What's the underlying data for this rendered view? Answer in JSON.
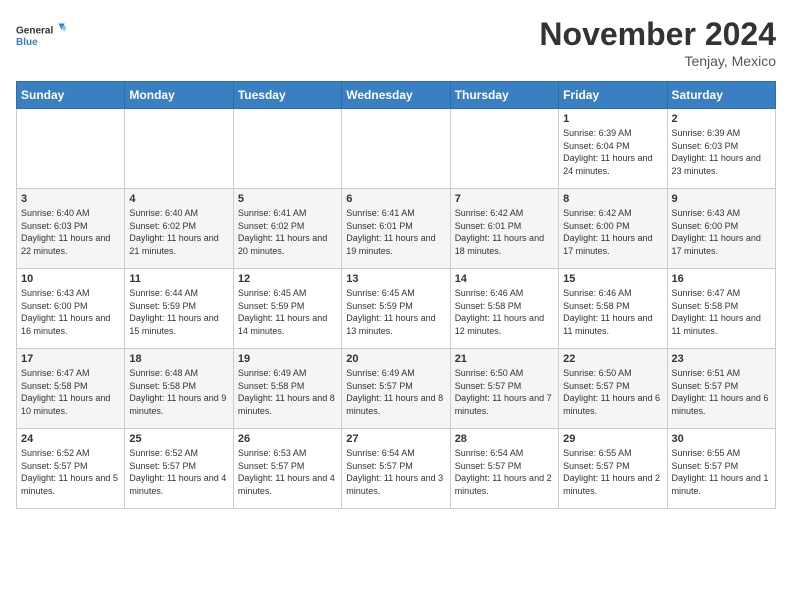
{
  "header": {
    "logo_general": "General",
    "logo_blue": "Blue",
    "month_title": "November 2024",
    "location": "Tenjay, Mexico"
  },
  "days_of_week": [
    "Sunday",
    "Monday",
    "Tuesday",
    "Wednesday",
    "Thursday",
    "Friday",
    "Saturday"
  ],
  "weeks": [
    [
      {
        "day": "",
        "info": ""
      },
      {
        "day": "",
        "info": ""
      },
      {
        "day": "",
        "info": ""
      },
      {
        "day": "",
        "info": ""
      },
      {
        "day": "",
        "info": ""
      },
      {
        "day": "1",
        "info": "Sunrise: 6:39 AM\nSunset: 6:04 PM\nDaylight: 11 hours and 24 minutes."
      },
      {
        "day": "2",
        "info": "Sunrise: 6:39 AM\nSunset: 6:03 PM\nDaylight: 11 hours and 23 minutes."
      }
    ],
    [
      {
        "day": "3",
        "info": "Sunrise: 6:40 AM\nSunset: 6:03 PM\nDaylight: 11 hours and 22 minutes."
      },
      {
        "day": "4",
        "info": "Sunrise: 6:40 AM\nSunset: 6:02 PM\nDaylight: 11 hours and 21 minutes."
      },
      {
        "day": "5",
        "info": "Sunrise: 6:41 AM\nSunset: 6:02 PM\nDaylight: 11 hours and 20 minutes."
      },
      {
        "day": "6",
        "info": "Sunrise: 6:41 AM\nSunset: 6:01 PM\nDaylight: 11 hours and 19 minutes."
      },
      {
        "day": "7",
        "info": "Sunrise: 6:42 AM\nSunset: 6:01 PM\nDaylight: 11 hours and 18 minutes."
      },
      {
        "day": "8",
        "info": "Sunrise: 6:42 AM\nSunset: 6:00 PM\nDaylight: 11 hours and 17 minutes."
      },
      {
        "day": "9",
        "info": "Sunrise: 6:43 AM\nSunset: 6:00 PM\nDaylight: 11 hours and 17 minutes."
      }
    ],
    [
      {
        "day": "10",
        "info": "Sunrise: 6:43 AM\nSunset: 6:00 PM\nDaylight: 11 hours and 16 minutes."
      },
      {
        "day": "11",
        "info": "Sunrise: 6:44 AM\nSunset: 5:59 PM\nDaylight: 11 hours and 15 minutes."
      },
      {
        "day": "12",
        "info": "Sunrise: 6:45 AM\nSunset: 5:59 PM\nDaylight: 11 hours and 14 minutes."
      },
      {
        "day": "13",
        "info": "Sunrise: 6:45 AM\nSunset: 5:59 PM\nDaylight: 11 hours and 13 minutes."
      },
      {
        "day": "14",
        "info": "Sunrise: 6:46 AM\nSunset: 5:58 PM\nDaylight: 11 hours and 12 minutes."
      },
      {
        "day": "15",
        "info": "Sunrise: 6:46 AM\nSunset: 5:58 PM\nDaylight: 11 hours and 11 minutes."
      },
      {
        "day": "16",
        "info": "Sunrise: 6:47 AM\nSunset: 5:58 PM\nDaylight: 11 hours and 11 minutes."
      }
    ],
    [
      {
        "day": "17",
        "info": "Sunrise: 6:47 AM\nSunset: 5:58 PM\nDaylight: 11 hours and 10 minutes."
      },
      {
        "day": "18",
        "info": "Sunrise: 6:48 AM\nSunset: 5:58 PM\nDaylight: 11 hours and 9 minutes."
      },
      {
        "day": "19",
        "info": "Sunrise: 6:49 AM\nSunset: 5:58 PM\nDaylight: 11 hours and 8 minutes."
      },
      {
        "day": "20",
        "info": "Sunrise: 6:49 AM\nSunset: 5:57 PM\nDaylight: 11 hours and 8 minutes."
      },
      {
        "day": "21",
        "info": "Sunrise: 6:50 AM\nSunset: 5:57 PM\nDaylight: 11 hours and 7 minutes."
      },
      {
        "day": "22",
        "info": "Sunrise: 6:50 AM\nSunset: 5:57 PM\nDaylight: 11 hours and 6 minutes."
      },
      {
        "day": "23",
        "info": "Sunrise: 6:51 AM\nSunset: 5:57 PM\nDaylight: 11 hours and 6 minutes."
      }
    ],
    [
      {
        "day": "24",
        "info": "Sunrise: 6:52 AM\nSunset: 5:57 PM\nDaylight: 11 hours and 5 minutes."
      },
      {
        "day": "25",
        "info": "Sunrise: 6:52 AM\nSunset: 5:57 PM\nDaylight: 11 hours and 4 minutes."
      },
      {
        "day": "26",
        "info": "Sunrise: 6:53 AM\nSunset: 5:57 PM\nDaylight: 11 hours and 4 minutes."
      },
      {
        "day": "27",
        "info": "Sunrise: 6:54 AM\nSunset: 5:57 PM\nDaylight: 11 hours and 3 minutes."
      },
      {
        "day": "28",
        "info": "Sunrise: 6:54 AM\nSunset: 5:57 PM\nDaylight: 11 hours and 2 minutes."
      },
      {
        "day": "29",
        "info": "Sunrise: 6:55 AM\nSunset: 5:57 PM\nDaylight: 11 hours and 2 minutes."
      },
      {
        "day": "30",
        "info": "Sunrise: 6:55 AM\nSunset: 5:57 PM\nDaylight: 11 hours and 1 minute."
      }
    ]
  ]
}
